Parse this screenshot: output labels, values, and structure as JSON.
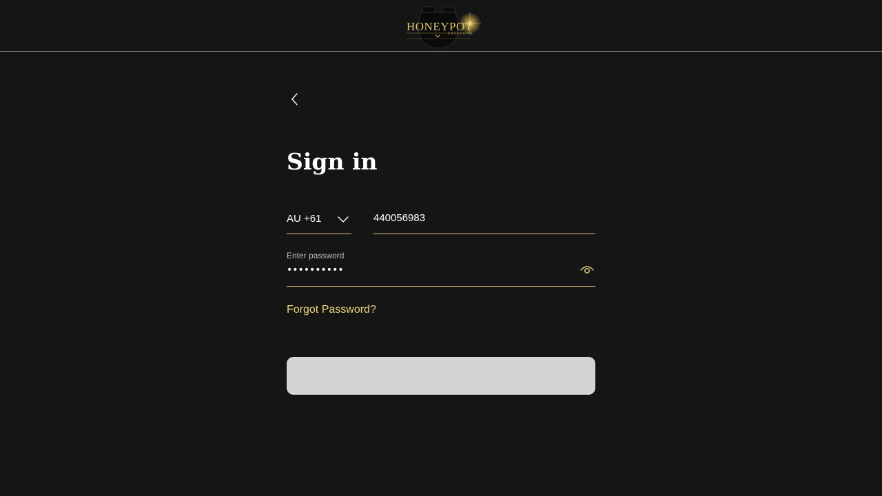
{
  "header": {
    "logo_text": "HONEYPOT",
    "logo_subtext": "EXCLUSIVE"
  },
  "page": {
    "title": "Sign in"
  },
  "form": {
    "country_code": "AU +61",
    "phone_value": "440056983",
    "password_label": "Enter password",
    "password_value": "••••••••••",
    "forgot_label": "Forgot Password?"
  },
  "colors": {
    "background": "#151515",
    "accent": "#e5d27a",
    "button_disabled": "#d4d4d4"
  },
  "icons": {
    "back": "chevron-left-icon",
    "country_dropdown": "chevron-down-icon",
    "password_toggle": "eye-icon",
    "loading": "spinner-icon"
  }
}
